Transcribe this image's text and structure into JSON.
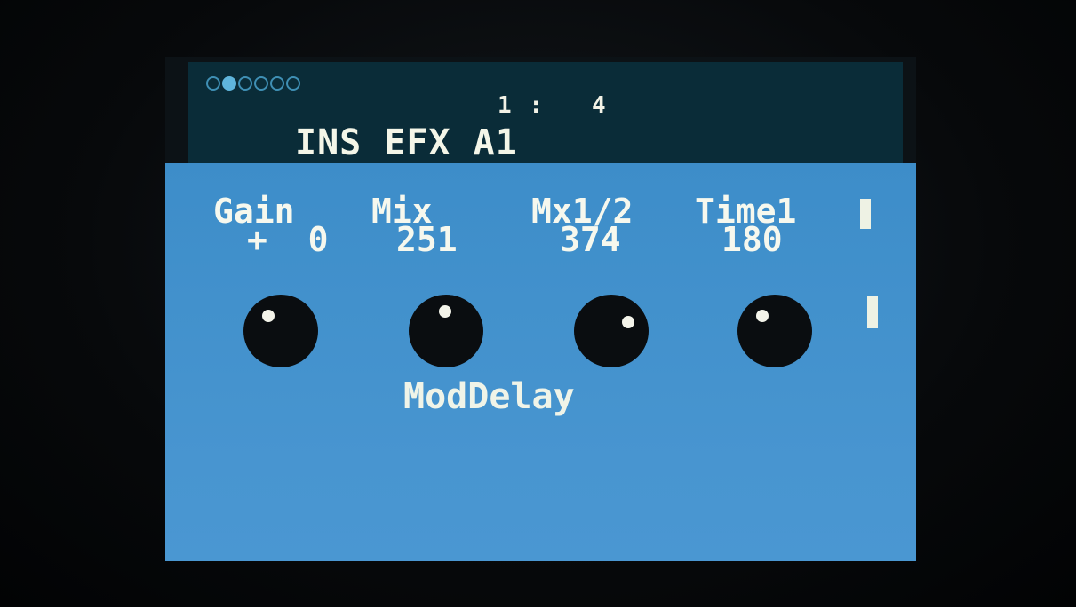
{
  "header": {
    "page_count": 6,
    "active_page": 2,
    "counter_left": "1",
    "counter_sep": ":",
    "counter_right": "4",
    "title": "INS EFX A1"
  },
  "params": [
    {
      "label": "Gain",
      "value": "+  0",
      "knob_level": 0.35
    },
    {
      "label": "Mix",
      "value": "251",
      "knob_level": 0.49
    },
    {
      "label": "Mx1/2",
      "value": "374",
      "knob_level": 0.73
    },
    {
      "label": "Time1",
      "value": "180",
      "knob_level": 0.35
    }
  ],
  "effect_name": "ModDelay",
  "colors": {
    "header_bg": "#0a2c38",
    "main_bg": "#4291cc",
    "text": "#f6f8ee",
    "knob": "#0a0d10"
  }
}
